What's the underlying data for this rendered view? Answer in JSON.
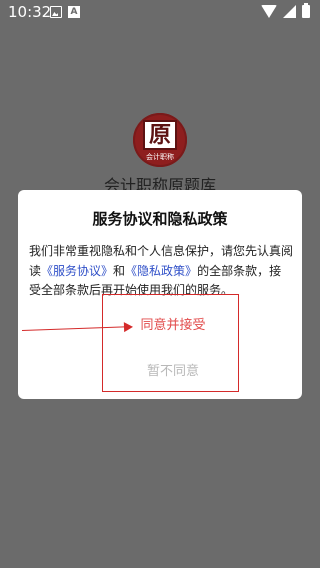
{
  "status_bar": {
    "time": "10:32",
    "icons": [
      "image-icon",
      "a-icon",
      "wifi-icon",
      "signal-icon",
      "battery-icon"
    ],
    "a_glyph": "A"
  },
  "app": {
    "logo_char": "原",
    "logo_subtitle": "会计职称",
    "name": "会计职称原题库"
  },
  "dialog": {
    "title": "服务协议和隐私政策",
    "body_part1": "我们非常重视隐私和个人信息保护，请您先认真阅读",
    "service_link": "《服务协议》",
    "body_and": "和",
    "privacy_link": "《隐私政策》",
    "body_part2": "的全部条款，接受全部条款后再开始使用我们的服务。",
    "agree_button": "同意并接受",
    "disagree_button": "暂不同意"
  },
  "colors": {
    "overlay": "#6b6b6b",
    "accent_red": "#e24b4b",
    "link_blue": "#3050c8",
    "annotation_red": "#d42a2a"
  }
}
